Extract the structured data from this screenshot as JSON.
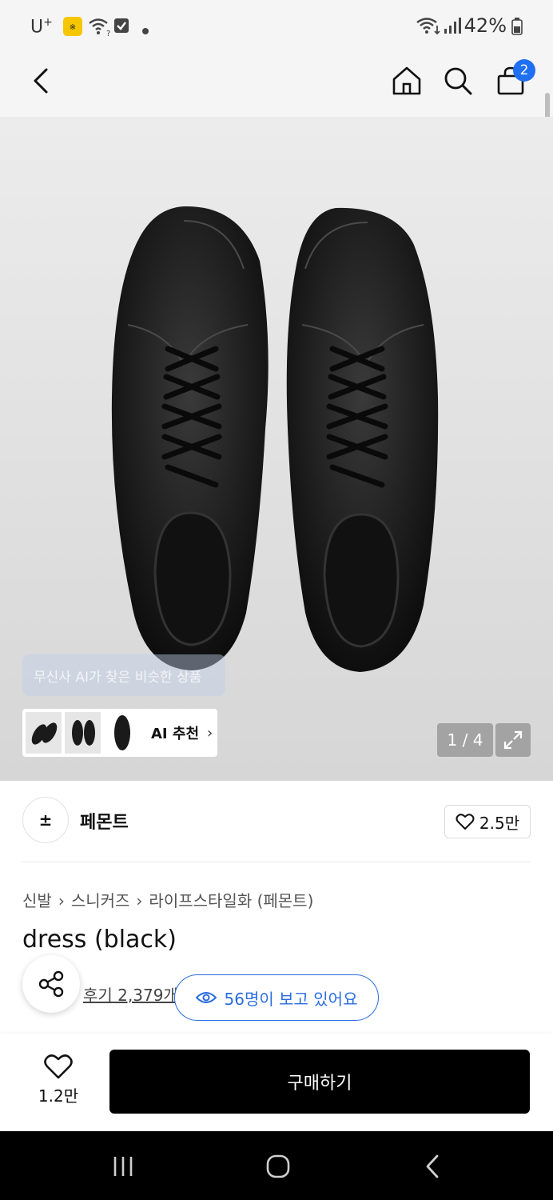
{
  "status_bar": {
    "carrier": "U",
    "carrier_sup": "+",
    "battery": "42%"
  },
  "header": {
    "cart_count": "2"
  },
  "hero": {
    "ai_tooltip": "무신사 AI가 찾은 비슷한 상품",
    "ai_reco_label": "AI 추천",
    "image_counter": "1 / 4"
  },
  "brand": {
    "logo_symbol": "±",
    "name": "페몬트",
    "likes": "2.5만"
  },
  "breadcrumb": [
    "신발",
    "스니커즈",
    "라이프스타일화 (페몬트)"
  ],
  "product": {
    "title": "dress (black)",
    "reviews": "후기 2,379개",
    "viewers": "56명이 보고 있어요"
  },
  "bottom_bar": {
    "wish_count": "1.2만",
    "buy_label": "구매하기"
  },
  "colors": {
    "accent": "#1e6ff2",
    "viewer_pill": "#2a6de0",
    "buy_button": "#000000"
  }
}
